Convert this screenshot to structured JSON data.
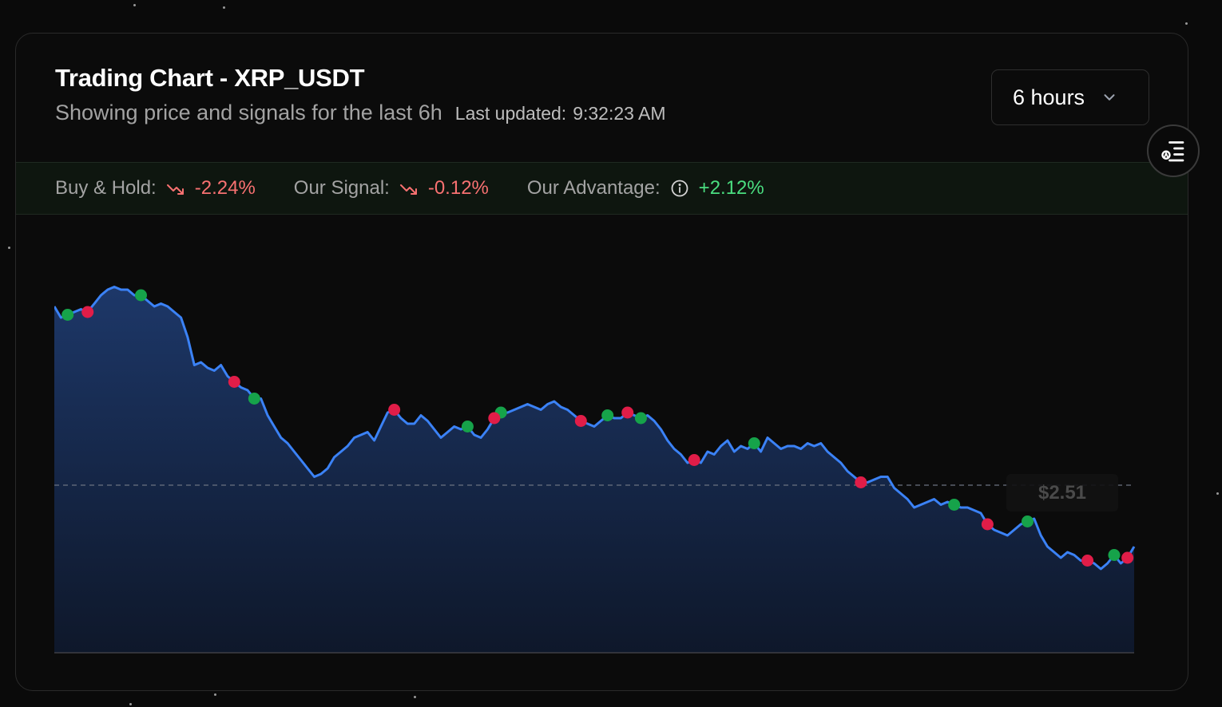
{
  "header": {
    "title": "Trading Chart - XRP_USDT",
    "subtitle": "Showing price and signals for the last 6h",
    "updated_label": "Last updated:",
    "updated_time": "9:32:23 AM"
  },
  "timeframe_select": {
    "value": "6 hours",
    "icon": "chevron-down-icon"
  },
  "stats": {
    "buy_hold": {
      "label": "Buy & Hold:",
      "value": "-2.24%",
      "icon": "trending-down-icon"
    },
    "our_signal": {
      "label": "Our Signal:",
      "value": "-0.12%",
      "icon": "trending-down-icon"
    },
    "advantage": {
      "label": "Our Advantage:",
      "value": "+2.12%",
      "icon": "info-icon"
    }
  },
  "panel_toggle": {
    "icon": "list-filter-icon"
  },
  "colors": {
    "line": "#3b82f6",
    "buy_signal": "#16a34a",
    "sell_signal": "#e11d48",
    "negative": "#f87171",
    "positive": "#4ade80"
  },
  "tooltip": {
    "value": "$2.51"
  },
  "chart_data": {
    "type": "area",
    "title": "",
    "xlabel": "",
    "ylabel": "",
    "ylim": [
      0,
      100
    ],
    "grid": false,
    "reference_line": {
      "style": "dashed",
      "value": 36
    },
    "series": [
      {
        "values": [
          100,
          96,
          97,
          98,
          99,
          98,
          101,
          104,
          106,
          107,
          106,
          106,
          104,
          104,
          102,
          100,
          101,
          100,
          98,
          96,
          89,
          79,
          80,
          78,
          77,
          79,
          75,
          73,
          71,
          70,
          67,
          67,
          61,
          57,
          53,
          51,
          48,
          45,
          42,
          39,
          40,
          42,
          46,
          48,
          50,
          53,
          54,
          55,
          52,
          57,
          62,
          63,
          60,
          58,
          58,
          61,
          59,
          56,
          53,
          55,
          57,
          56,
          57,
          54,
          53,
          56,
          60,
          62,
          62,
          63,
          64,
          65,
          64,
          63,
          65,
          66,
          64,
          63,
          61,
          59,
          58,
          57,
          59,
          61,
          60,
          60,
          62,
          61,
          60,
          61,
          59,
          56,
          52,
          49,
          47,
          44,
          45,
          44,
          48,
          47,
          50,
          52,
          48,
          50,
          49,
          51,
          48,
          53,
          51,
          49,
          50,
          50,
          49,
          51,
          50,
          51,
          48,
          46,
          44,
          41,
          39,
          37,
          37,
          38,
          39,
          39,
          35,
          33,
          31,
          28,
          29,
          30,
          31,
          29,
          30,
          29,
          28,
          28,
          27,
          26,
          22,
          20,
          19,
          18,
          20,
          22,
          23,
          24,
          18,
          14,
          12,
          10,
          12,
          11,
          9,
          9,
          8,
          6,
          8,
          11,
          8,
          10,
          14
        ],
        "trend_note": ""
      }
    ],
    "signals": {
      "buy": [
        {
          "i": 2
        },
        {
          "i": 13
        },
        {
          "i": 30
        },
        {
          "i": 62
        },
        {
          "i": 67
        },
        {
          "i": 83
        },
        {
          "i": 88
        },
        {
          "i": 105
        },
        {
          "i": 135
        },
        {
          "i": 146
        },
        {
          "i": 159
        }
      ],
      "sell": [
        {
          "i": 5
        },
        {
          "i": 27
        },
        {
          "i": 51
        },
        {
          "i": 66
        },
        {
          "i": 79
        },
        {
          "i": 86
        },
        {
          "i": 96
        },
        {
          "i": 121
        },
        {
          "i": 140
        },
        {
          "i": 155
        },
        {
          "i": 161
        }
      ]
    }
  }
}
